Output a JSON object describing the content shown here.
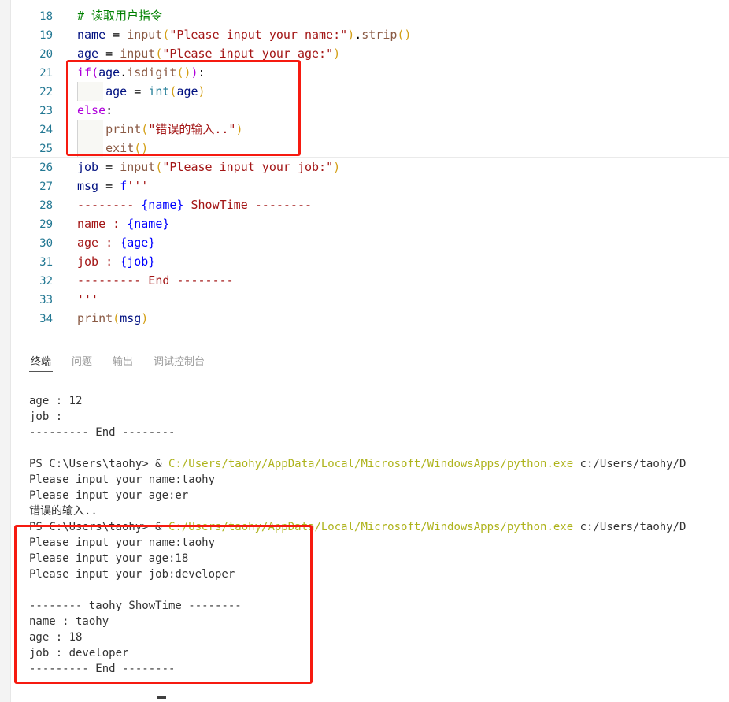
{
  "window": {
    "app": "vscode-like-editor"
  },
  "editor": {
    "first_partial_line_number": "17",
    "lines": [
      {
        "num": "18",
        "active": false,
        "tokens": [
          {
            "cls": "t-comment",
            "text": "# 读取用户指令"
          }
        ]
      },
      {
        "num": "19",
        "active": false,
        "tokens": [
          {
            "cls": "t-var",
            "text": "name"
          },
          {
            "cls": "t-op",
            "text": " = "
          },
          {
            "cls": "t-fn2",
            "text": "input"
          },
          {
            "cls": "t-paren",
            "text": "("
          },
          {
            "cls": "t-str",
            "text": "\"Please input your name:\""
          },
          {
            "cls": "t-paren",
            "text": ")"
          },
          {
            "cls": "t-op",
            "text": "."
          },
          {
            "cls": "t-fn2",
            "text": "strip"
          },
          {
            "cls": "t-paren",
            "text": "()"
          }
        ]
      },
      {
        "num": "20",
        "active": false,
        "tokens": [
          {
            "cls": "t-var",
            "text": "age"
          },
          {
            "cls": "t-op",
            "text": " = "
          },
          {
            "cls": "t-fn2",
            "text": "input"
          },
          {
            "cls": "t-paren",
            "text": "("
          },
          {
            "cls": "t-str",
            "text": "\"Please input your age:\""
          },
          {
            "cls": "t-paren",
            "text": ")"
          }
        ]
      },
      {
        "num": "21",
        "active": false,
        "tokens": [
          {
            "cls": "t-kw",
            "text": "if"
          },
          {
            "cls": "t-paren2",
            "text": "("
          },
          {
            "cls": "t-var",
            "text": "age"
          },
          {
            "cls": "t-op",
            "text": "."
          },
          {
            "cls": "t-fn2",
            "text": "isdigit"
          },
          {
            "cls": "t-paren",
            "text": "()"
          },
          {
            "cls": "t-paren2",
            "text": ")"
          },
          {
            "cls": "t-op",
            "text": ":"
          }
        ]
      },
      {
        "num": "22",
        "active": false,
        "indent": true,
        "tokens": [
          {
            "cls": "t-plain",
            "text": "    "
          },
          {
            "cls": "t-var",
            "text": "age"
          },
          {
            "cls": "t-op",
            "text": " = "
          },
          {
            "cls": "t-type",
            "text": "int"
          },
          {
            "cls": "t-paren",
            "text": "("
          },
          {
            "cls": "t-var",
            "text": "age"
          },
          {
            "cls": "t-paren",
            "text": ")"
          }
        ]
      },
      {
        "num": "23",
        "active": false,
        "tokens": [
          {
            "cls": "t-kw",
            "text": "else"
          },
          {
            "cls": "t-op",
            "text": ":"
          }
        ]
      },
      {
        "num": "24",
        "active": false,
        "indent": true,
        "tokens": [
          {
            "cls": "t-plain",
            "text": "    "
          },
          {
            "cls": "t-fn2",
            "text": "print"
          },
          {
            "cls": "t-paren",
            "text": "("
          },
          {
            "cls": "t-str",
            "text": "\"错误的输入..\""
          },
          {
            "cls": "t-paren",
            "text": ")"
          }
        ]
      },
      {
        "num": "25",
        "active": true,
        "indent": true,
        "tokens": [
          {
            "cls": "t-plain",
            "text": "    "
          },
          {
            "cls": "t-fn2",
            "text": "exit"
          },
          {
            "cls": "t-paren",
            "text": "()"
          }
        ]
      },
      {
        "num": "26",
        "active": false,
        "tokens": [
          {
            "cls": "t-var",
            "text": "job"
          },
          {
            "cls": "t-op",
            "text": " = "
          },
          {
            "cls": "t-fn2",
            "text": "input"
          },
          {
            "cls": "t-paren",
            "text": "("
          },
          {
            "cls": "t-str",
            "text": "\"Please input your job:\""
          },
          {
            "cls": "t-paren",
            "text": ")"
          }
        ]
      },
      {
        "num": "27",
        "active": false,
        "tokens": [
          {
            "cls": "t-var",
            "text": "msg"
          },
          {
            "cls": "t-op",
            "text": " = "
          },
          {
            "cls": "t-fstr",
            "text": "f"
          },
          {
            "cls": "t-str",
            "text": "'''"
          }
        ]
      },
      {
        "num": "28",
        "active": false,
        "tokens": [
          {
            "cls": "t-str",
            "text": "-------- "
          },
          {
            "cls": "t-fstr",
            "text": "{name}"
          },
          {
            "cls": "t-str",
            "text": " ShowTime --------"
          }
        ]
      },
      {
        "num": "29",
        "active": false,
        "tokens": [
          {
            "cls": "t-str",
            "text": "name : "
          },
          {
            "cls": "t-fstr",
            "text": "{name}"
          }
        ]
      },
      {
        "num": "30",
        "active": false,
        "tokens": [
          {
            "cls": "t-str",
            "text": "age : "
          },
          {
            "cls": "t-fstr",
            "text": "{age}"
          }
        ]
      },
      {
        "num": "31",
        "active": false,
        "tokens": [
          {
            "cls": "t-str",
            "text": "job : "
          },
          {
            "cls": "t-fstr",
            "text": "{job}"
          }
        ]
      },
      {
        "num": "32",
        "active": false,
        "tokens": [
          {
            "cls": "t-str",
            "text": "--------- End --------"
          }
        ]
      },
      {
        "num": "33",
        "active": false,
        "tokens": [
          {
            "cls": "t-str",
            "text": "'''"
          }
        ]
      },
      {
        "num": "34",
        "active": false,
        "tokens": [
          {
            "cls": "t-fn2",
            "text": "print"
          },
          {
            "cls": "t-paren",
            "text": "("
          },
          {
            "cls": "t-var",
            "text": "msg"
          },
          {
            "cls": "t-paren",
            "text": ")"
          }
        ]
      }
    ]
  },
  "panel": {
    "tabs": [
      {
        "label": "终端",
        "active": true
      },
      {
        "label": "问题",
        "active": false
      },
      {
        "label": "输出",
        "active": false
      },
      {
        "label": "调试控制台",
        "active": false
      }
    ],
    "terminal_lines": [
      {
        "segments": [
          {
            "cls": "tc-default",
            "text": "age : 12"
          }
        ]
      },
      {
        "segments": [
          {
            "cls": "tc-default",
            "text": "job : "
          }
        ]
      },
      {
        "segments": [
          {
            "cls": "tc-default",
            "text": "--------- End --------"
          }
        ]
      },
      {
        "segments": [
          {
            "cls": "tc-default",
            "text": " "
          }
        ]
      },
      {
        "segments": [
          {
            "cls": "tc-default",
            "text": "PS C:\\Users\\taohy> & "
          },
          {
            "cls": "tc-path",
            "text": "C:/Users/taohy/AppData/Local/Microsoft/WindowsApps/python.exe"
          },
          {
            "cls": "tc-default",
            "text": " c:/Users/taohy/D"
          }
        ]
      },
      {
        "segments": [
          {
            "cls": "tc-default",
            "text": "Please input your name:taohy"
          }
        ]
      },
      {
        "segments": [
          {
            "cls": "tc-default",
            "text": "Please input your age:er"
          }
        ]
      },
      {
        "segments": [
          {
            "cls": "tc-default",
            "text": "错误的输入.."
          }
        ]
      },
      {
        "segments": [
          {
            "cls": "tc-default",
            "text": "PS C:\\Users\\taohy> & "
          },
          {
            "cls": "tc-path",
            "text": "C:/Users/taohy/AppData/Local/Microsoft/WindowsApps/python.exe"
          },
          {
            "cls": "tc-default",
            "text": " c:/Users/taohy/D"
          }
        ]
      },
      {
        "segments": [
          {
            "cls": "tc-default",
            "text": "Please input your name:taohy"
          }
        ]
      },
      {
        "segments": [
          {
            "cls": "tc-default",
            "text": "Please input your age:18"
          }
        ]
      },
      {
        "segments": [
          {
            "cls": "tc-default",
            "text": "Please input your job:developer"
          }
        ]
      },
      {
        "segments": [
          {
            "cls": "tc-default",
            "text": " "
          }
        ]
      },
      {
        "segments": [
          {
            "cls": "tc-default",
            "text": "-------- taohy ShowTime --------"
          }
        ]
      },
      {
        "segments": [
          {
            "cls": "tc-default",
            "text": "name : taohy"
          }
        ]
      },
      {
        "segments": [
          {
            "cls": "tc-default",
            "text": "age : 18"
          }
        ]
      },
      {
        "segments": [
          {
            "cls": "tc-default",
            "text": "job : developer"
          }
        ]
      },
      {
        "segments": [
          {
            "cls": "tc-default",
            "text": "--------- End --------"
          }
        ]
      }
    ]
  },
  "annotations": {
    "colors": {
      "highlight_box": "#f61a10"
    },
    "boxes": [
      {
        "name": "code-if-else-block"
      },
      {
        "name": "terminal-success-run"
      }
    ]
  }
}
